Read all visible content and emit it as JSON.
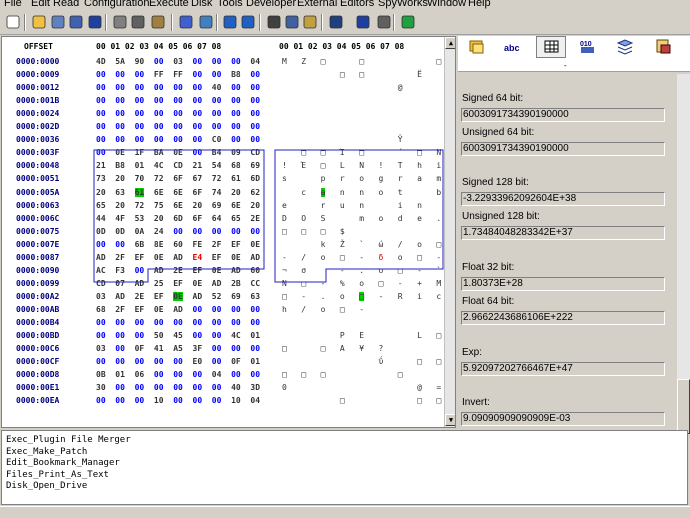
{
  "menu": [
    "File",
    "Edit",
    "Read",
    "Configuration",
    "Execute",
    "Disk",
    "Tools",
    "Developer",
    "External",
    "Editors",
    "SpyWorks",
    "Window",
    "Help"
  ],
  "toolbar_icons": [
    "new-icon",
    "open-icon",
    "open-disk-icon",
    "close-icon",
    "save-icon",
    "print-icon",
    "print-preview-icon",
    "options-icon",
    "help-icon",
    "about-icon",
    "undo-icon",
    "redo-icon",
    "cut-icon",
    "copy-icon",
    "paste-icon",
    "find-icon",
    "goto-icon",
    "calculator-icon",
    "web-icon"
  ],
  "hex": {
    "header_offset": "OFFSET",
    "header_bytes": "00 01 02 03 04 05 06 07 08",
    "header_chars": "00 01 02 03 04 05 06 07 08",
    "rows": [
      {
        "addr": "0000:0000",
        "bytes": [
          "4D",
          "5A",
          "90",
          "00",
          "03",
          "00",
          "00",
          "00",
          "04"
        ],
        "chars": [
          "M",
          "Z",
          "□",
          "",
          "□",
          "",
          "",
          "",
          "□"
        ]
      },
      {
        "addr": "0000:0009",
        "bytes": [
          "00",
          "00",
          "00",
          "FF",
          "FF",
          "00",
          "00",
          "B8",
          "00"
        ],
        "chars": [
          "",
          "",
          "",
          "□",
          "□",
          "",
          "",
          "Ë",
          ""
        ]
      },
      {
        "addr": "0000:0012",
        "bytes": [
          "00",
          "00",
          "00",
          "00",
          "00",
          "00",
          "40",
          "00",
          "00"
        ],
        "chars": [
          "",
          "",
          "",
          "",
          "",
          "",
          "@",
          "",
          ""
        ]
      },
      {
        "addr": "0000:001B",
        "bytes": [
          "00",
          "00",
          "00",
          "00",
          "00",
          "00",
          "00",
          "00",
          "00"
        ],
        "chars": [
          "",
          "",
          "",
          "",
          "",
          "",
          "",
          "",
          ""
        ]
      },
      {
        "addr": "0000:0024",
        "bytes": [
          "00",
          "00",
          "00",
          "00",
          "00",
          "00",
          "00",
          "00",
          "00"
        ],
        "chars": [
          "",
          "",
          "",
          "",
          "",
          "",
          "",
          "",
          ""
        ]
      },
      {
        "addr": "0000:002D",
        "bytes": [
          "00",
          "00",
          "00",
          "00",
          "00",
          "00",
          "00",
          "00",
          "00"
        ],
        "chars": [
          "",
          "",
          "",
          "",
          "",
          "",
          "",
          "",
          ""
        ]
      },
      {
        "addr": "0000:0036",
        "bytes": [
          "00",
          "00",
          "00",
          "00",
          "00",
          "00",
          "C0",
          "00",
          "00"
        ],
        "chars": [
          "",
          "",
          "",
          "",
          "",
          "",
          "Ŷ",
          "",
          ""
        ]
      },
      {
        "addr": "0000:003F",
        "bytes": [
          "00",
          "0E",
          "1F",
          "BA",
          "0E",
          "00",
          "B4",
          "09",
          "CD"
        ],
        "chars": [
          "",
          "□",
          "□",
          "Ί",
          "□",
          "",
          "´",
          "□",
          "Ν"
        ]
      },
      {
        "addr": "0000:0048",
        "bytes": [
          "21",
          "B8",
          "01",
          "4C",
          "CD",
          "21",
          "54",
          "68",
          "69"
        ],
        "chars": [
          "!",
          "Έ",
          "□",
          "L",
          "Ν",
          "!",
          "T",
          "h",
          "i"
        ]
      },
      {
        "addr": "0000:0051",
        "bytes": [
          "73",
          "20",
          "70",
          "72",
          "6F",
          "67",
          "72",
          "61",
          "6D"
        ],
        "chars": [
          "s",
          " ",
          "p",
          "r",
          "o",
          "g",
          "r",
          "a",
          "m"
        ]
      },
      {
        "addr": "0000:005A",
        "bytes": [
          "20",
          "63",
          "61",
          "6E",
          "6E",
          "6F",
          "74",
          "20",
          "62"
        ],
        "chars": [
          " ",
          "c",
          "a",
          "n",
          "n",
          "o",
          "t",
          " ",
          "b"
        ]
      },
      {
        "addr": "0000:0063",
        "bytes": [
          "65",
          "20",
          "72",
          "75",
          "6E",
          "20",
          "69",
          "6E",
          "20"
        ],
        "chars": [
          "e",
          " ",
          "r",
          "u",
          "n",
          " ",
          "i",
          "n",
          " "
        ]
      },
      {
        "addr": "0000:006C",
        "bytes": [
          "44",
          "4F",
          "53",
          "20",
          "6D",
          "6F",
          "64",
          "65",
          "2E"
        ],
        "chars": [
          "D",
          "O",
          "S",
          " ",
          "m",
          "o",
          "d",
          "e",
          "."
        ]
      },
      {
        "addr": "0000:0075",
        "bytes": [
          "0D",
          "0D",
          "0A",
          "24",
          "00",
          "00",
          "00",
          "00",
          "00"
        ],
        "chars": [
          "□",
          "□",
          "□",
          "$",
          "",
          "",
          "",
          "",
          ""
        ]
      },
      {
        "addr": "0000:007E",
        "bytes": [
          "00",
          "00",
          "6B",
          "8E",
          "60",
          "FE",
          "2F",
          "EF",
          "0E"
        ],
        "chars": [
          "",
          "",
          "k",
          "Ž",
          "`",
          "ώ",
          "/",
          "ο",
          "□"
        ]
      },
      {
        "addr": "0000:0087",
        "bytes": [
          "AD",
          "2F",
          "EF",
          "0E",
          "AD",
          "E4",
          "EF",
          "0E",
          "AD"
        ],
        "chars": [
          "-",
          "/",
          "ο",
          "□",
          "-",
          "δ",
          "ο",
          "□",
          "-"
        ]
      },
      {
        "addr": "0000:0090",
        "bytes": [
          "AC",
          "F3",
          "00",
          "AD",
          "2E",
          "EF",
          "0E",
          "AD",
          "60"
        ],
        "chars": [
          "¬",
          "σ",
          "",
          "-",
          ".",
          "ο",
          "□",
          "-",
          "`"
        ]
      },
      {
        "addr": "0000:0099",
        "bytes": [
          "CD",
          "07",
          "AD",
          "25",
          "EF",
          "0E",
          "AD",
          "2B",
          "CC"
        ],
        "chars": [
          "Ν",
          "□",
          "-",
          "%",
          "ο",
          "□",
          "-",
          "+",
          "Μ"
        ]
      },
      {
        "addr": "0000:00A2",
        "bytes": [
          "03",
          "AD",
          "2E",
          "EF",
          "0E",
          "AD",
          "52",
          "69",
          "63"
        ],
        "chars": [
          "□",
          "-",
          ".",
          "ο",
          "□",
          "-",
          "R",
          "i",
          "c"
        ]
      },
      {
        "addr": "0000:00AB",
        "bytes": [
          "68",
          "2F",
          "EF",
          "0E",
          "AD",
          "00",
          "00",
          "00",
          "00"
        ],
        "chars": [
          "h",
          "/",
          "ο",
          "□",
          "-",
          "",
          "",
          "",
          ""
        ]
      },
      {
        "addr": "0000:00B4",
        "bytes": [
          "00",
          "00",
          "00",
          "00",
          "00",
          "00",
          "00",
          "00",
          "00"
        ],
        "chars": [
          "",
          "",
          "",
          "",
          "",
          "",
          "",
          "",
          ""
        ]
      },
      {
        "addr": "0000:00BD",
        "bytes": [
          "00",
          "00",
          "00",
          "50",
          "45",
          "00",
          "00",
          "4C",
          "01"
        ],
        "chars": [
          "",
          "",
          "",
          "P",
          "E",
          "",
          "",
          "L",
          "□"
        ]
      },
      {
        "addr": "0000:00C6",
        "bytes": [
          "03",
          "00",
          "0F",
          "41",
          "A5",
          "3F",
          "00",
          "00",
          "00"
        ],
        "chars": [
          "□",
          "",
          "□",
          "A",
          "¥",
          "?",
          "",
          "",
          ""
        ]
      },
      {
        "addr": "0000:00CF",
        "bytes": [
          "00",
          "00",
          "00",
          "00",
          "00",
          "E0",
          "00",
          "0F",
          "01"
        ],
        "chars": [
          "",
          "",
          "",
          "",
          "",
          "ΰ",
          "",
          "□",
          "□"
        ]
      },
      {
        "addr": "0000:00D8",
        "bytes": [
          "0B",
          "01",
          "06",
          "00",
          "00",
          "00",
          "04",
          "00",
          "00"
        ],
        "chars": [
          "□",
          "□",
          "□",
          "",
          "",
          "",
          "□",
          "",
          ""
        ]
      },
      {
        "addr": "0000:00E1",
        "bytes": [
          "30",
          "00",
          "00",
          "00",
          "00",
          "00",
          "00",
          "40",
          "3D"
        ],
        "chars": [
          "0",
          "",
          "",
          "",
          "",
          "",
          "",
          "@",
          "="
        ]
      },
      {
        "addr": "0000:00EA",
        "bytes": [
          "00",
          "00",
          "00",
          "10",
          "00",
          "00",
          "00",
          "10",
          "04"
        ],
        "chars": [
          "",
          "",
          "",
          "□",
          "",
          "",
          "",
          "□",
          "□"
        ]
      }
    ]
  },
  "right": {
    "tabs": [
      "bookmarks-icon",
      "abc-icon",
      "grid-icon",
      "bits-icon",
      "layers-icon",
      "disk-icon"
    ],
    "dot": "-",
    "fields": [
      {
        "label": "Signed 64 bit:",
        "value": "6003091734390190000"
      },
      {
        "label": "Unsigned 64 bit:",
        "value": "6003091734390190000"
      },
      {
        "label": "Signed 128 bit:",
        "value": "-3.22933962092604E+38"
      },
      {
        "label": "Unsigned 128 bit:",
        "value": "1.73484048283342E+37"
      },
      {
        "label": "Float 32 bit:",
        "value": "1.80373E+28"
      },
      {
        "label": "Float 64 bit:",
        "value": "2.9662243686106E+222"
      },
      {
        "label": "Exp:",
        "value": "5.92097202766467E+47"
      },
      {
        "label": "Invert:",
        "value": "9.09090909090909E-03"
      }
    ]
  },
  "macros": [
    "Exec_Plugin File Merger",
    "Exec_Make_Patch",
    "Edit_Bookmark_Manager",
    "Files_Print_As_Text",
    "Disk_Open_Drive"
  ],
  "colors": {
    "accent": "#0000ff",
    "selection": "#00d000",
    "frame": "#2020c0",
    "changed": "#e00000"
  }
}
